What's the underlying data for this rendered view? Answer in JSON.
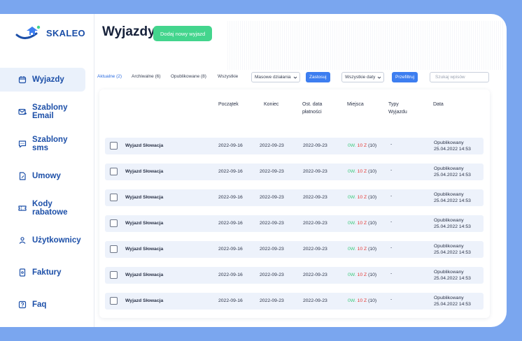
{
  "app": {
    "name": "SKALEO"
  },
  "sidebar": {
    "items": [
      {
        "label": "Wyjazdy",
        "icon": "calendar-icon",
        "active": true
      },
      {
        "label": "Szablony Email",
        "icon": "mail-icon",
        "active": false
      },
      {
        "label": "Szablony sms",
        "icon": "chat-icon",
        "active": false
      },
      {
        "label": "Umowy",
        "icon": "document-icon",
        "active": false
      },
      {
        "label": "Kody rabatowe",
        "icon": "ticket-icon",
        "active": false
      },
      {
        "label": "Użytkownicy",
        "icon": "user-icon",
        "active": false
      },
      {
        "label": "Faktury",
        "icon": "invoice-icon",
        "active": false
      },
      {
        "label": "Faq",
        "icon": "question-icon",
        "active": false
      }
    ]
  },
  "header": {
    "title": "Wyjazdy",
    "add_button": "Dodaj nowy wyjazd"
  },
  "toolbar": {
    "tabs": [
      "Aktualne (2)",
      "Archiwalne (6)",
      "Opublikowane (8)",
      "Wszystkie"
    ],
    "bulk_select": "Masowe działania",
    "apply_button": "Zastosuj",
    "dates_select": "Wszystkie daty",
    "filter_button": "Przefiltruj",
    "search_placeholder": "Szukaj wpisów"
  },
  "table": {
    "columns": [
      "Początek",
      "Koniec",
      "Ost. data płatności",
      "Miejsca",
      "Typy Wyjazdu",
      "Data"
    ],
    "rows": [
      {
        "name": "Wyjazd Słowacja",
        "start": "2022-09-16",
        "end": "2022-09-23",
        "payment": "2022-09-23",
        "places_free": "0W.",
        "places_taken": "10 Z",
        "places_total": "(10)",
        "type": "-",
        "status": "Opublikowany",
        "date": "25.04.2022 14:53"
      },
      {
        "name": "Wyjazd Słowacja",
        "start": "2022-09-16",
        "end": "2022-09-23",
        "payment": "2022-09-23",
        "places_free": "0W.",
        "places_taken": "10 Z",
        "places_total": "(10)",
        "type": "-",
        "status": "Opublikowany",
        "date": "25.04.2022 14:53"
      },
      {
        "name": "Wyjazd Słowacja",
        "start": "2022-09-16",
        "end": "2022-09-23",
        "payment": "2022-09-23",
        "places_free": "0W.",
        "places_taken": "10 Z",
        "places_total": "(10)",
        "type": "-",
        "status": "Opublikowany",
        "date": "25.04.2022 14:53"
      },
      {
        "name": "Wyjazd Słowacja",
        "start": "2022-09-16",
        "end": "2022-09-23",
        "payment": "2022-09-23",
        "places_free": "0W.",
        "places_taken": "10 Z",
        "places_total": "(10)",
        "type": "-",
        "status": "Opublikowany",
        "date": "25.04.2022 14:53"
      },
      {
        "name": "Wyjazd Słowacja",
        "start": "2022-09-16",
        "end": "2022-09-23",
        "payment": "2022-09-23",
        "places_free": "0W.",
        "places_taken": "10 Z",
        "places_total": "(10)",
        "type": "-",
        "status": "Opublikowany",
        "date": "25.04.2022 14:53"
      },
      {
        "name": "Wyjazd Słowacja",
        "start": "2022-09-16",
        "end": "2022-09-23",
        "payment": "2022-09-23",
        "places_free": "0W.",
        "places_taken": "10 Z",
        "places_total": "(10)",
        "type": "-",
        "status": "Opublikowany",
        "date": "25.04.2022 14:53"
      },
      {
        "name": "Wyjazd Słowacja",
        "start": "2022-09-16",
        "end": "2022-09-23",
        "payment": "2022-09-23",
        "places_free": "0W.",
        "places_taken": "10 Z",
        "places_total": "(10)",
        "type": "-",
        "status": "Opublikowany",
        "date": "25.04.2022 14:53"
      }
    ]
  },
  "colors": {
    "accent": "#3d7ef0",
    "brand": "#1c4fa8",
    "success": "#43d58d",
    "danger": "#e53935",
    "background": "#7aa6ef"
  }
}
